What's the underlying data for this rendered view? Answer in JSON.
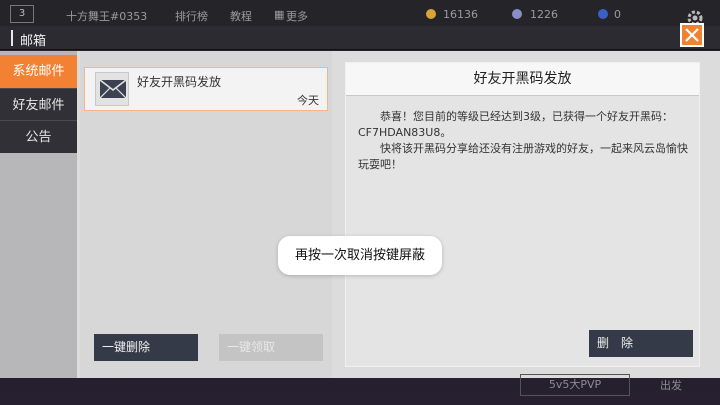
{
  "game_bar": {
    "level": "3",
    "player_name": "十方舞王#0353",
    "menu_rank": "排行榜",
    "menu_tutorial": "教程",
    "menu_more": "更多",
    "gold": "16136",
    "diamond": "1226",
    "tickets": "0"
  },
  "window": {
    "title": "邮箱"
  },
  "sidebar": {
    "items": [
      {
        "label": "系统邮件",
        "active": true
      },
      {
        "label": "好友邮件",
        "active": false
      },
      {
        "label": "公告",
        "active": false
      }
    ]
  },
  "mail_list": {
    "items": [
      {
        "subject": "好友开黑码发放",
        "date": "今天",
        "icon": "envelope-icon"
      }
    ],
    "delete_all_label": "一键删除",
    "claim_all_label": "一键领取"
  },
  "detail": {
    "title": "好友开黑码发放",
    "paragraph1": "恭喜！您目前的等级已经达到3级，已获得一个好友开黑码：CF7HDAN83U8。",
    "paragraph2": "快将该开黑码分享给还没有注册游戏的好友，一起来风云岛愉快玩耍吧！",
    "delete_label": "删　除"
  },
  "toast": {
    "text": "再按一次取消按键屏蔽"
  },
  "background": {
    "button_left": "5v5大PVP",
    "button_right": "出发"
  },
  "colors": {
    "accent": "#f28133",
    "dark_button": "#353a48"
  }
}
